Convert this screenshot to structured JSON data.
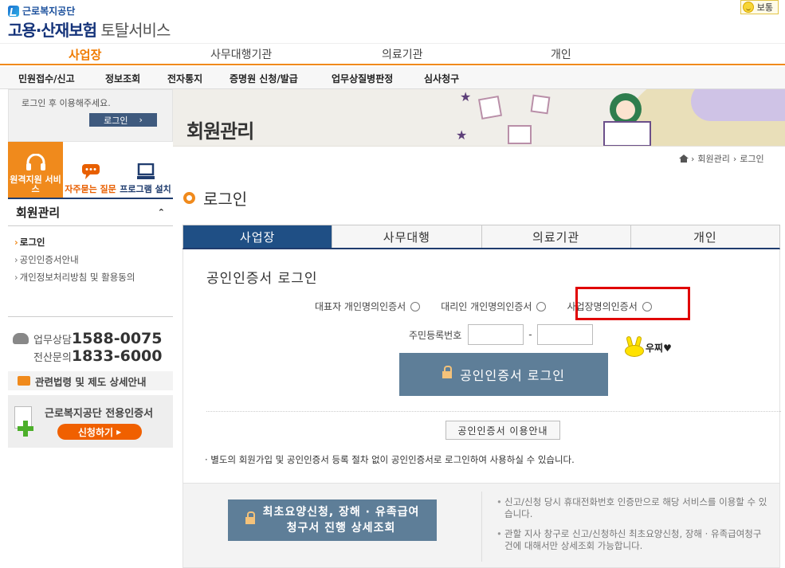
{
  "header": {
    "org_name": "근로복지공단",
    "service_strong": "고용·산재보험",
    "service_light": "토탈서비스",
    "mood_label": "보통"
  },
  "main_nav": [
    {
      "label": "사업장"
    },
    {
      "label": "사무대행기관"
    },
    {
      "label": "의료기관"
    },
    {
      "label": "개인"
    }
  ],
  "sub_nav": [
    {
      "label": "민원접수/신고"
    },
    {
      "label": "정보조회"
    },
    {
      "label": "전자통지"
    },
    {
      "label": "증명원 신청/발급"
    },
    {
      "label": "업무상질병판정"
    },
    {
      "label": "심사청구"
    }
  ],
  "sidebar": {
    "login_message": "로그인 후 이용해주세요.",
    "login_button": "로그인",
    "quick_links": [
      {
        "label": "원격지원 서비스",
        "icon": "headset-icon"
      },
      {
        "label": "자주묻는 질문",
        "icon": "chat-icon"
      },
      {
        "label": "프로그램 설치",
        "icon": "monitor-icon"
      }
    ],
    "menu_title": "회원관리",
    "menu_items": [
      {
        "label": "로그인"
      },
      {
        "label": "공인인증서안내"
      },
      {
        "label": "개인정보처리방침 및 활용동의"
      }
    ],
    "phone_line1_label": "업무상담",
    "phone_line1_number": "1588-0075",
    "phone_line2_label": "전산문의",
    "phone_line2_number": "1833-6000",
    "law_link": "관련법령 및 제도 상세안내",
    "cert_title": "근로복지공단 전용인증서",
    "cert_button": "신청하기"
  },
  "banner": {
    "title": "회원관리"
  },
  "breadcrumb": {
    "level1": "회원관리",
    "level2": "로그인"
  },
  "section_title": "로그인",
  "tabs": [
    {
      "label": "사업장"
    },
    {
      "label": "사무대행"
    },
    {
      "label": "의료기관"
    },
    {
      "label": "개인"
    }
  ],
  "login_panel": {
    "cert_login_title": "공인인증서 로그인",
    "radio_options": [
      {
        "label": "대표자 개인명의인증서"
      },
      {
        "label": "대리인 개인명의인증서"
      },
      {
        "label": "사업장명의인증서"
      }
    ],
    "ssn_label": "주민등록번호",
    "ssn_dash": "-",
    "login_button": "공인인증서 로그인",
    "guide_button": "공인인증서 이용안내",
    "note": "· 별도의 회원가입 및 공인인증서 등록 절차 없이 공인인증서로 로그인하여 사용하실 수 있습니다."
  },
  "annotation": {
    "label": "우찌♥"
  },
  "bottom": {
    "button_line1": "최초요양신청, 장해 · 유족급여",
    "button_line2": "청구서 진행 상세조회",
    "info1": "신고/신청 당시 휴대전화번호 인증만으로 해당 서비스를 이용할 수 있습니다.",
    "info2": "관할 지사 창구로 신고/신청하신 최초요양신청, 장해 · 유족급여청구건에 대해서만 상세조회 가능합니다."
  },
  "colors": {
    "accent_orange": "#f08a1c",
    "navy": "#1f4f85",
    "button_slate": "#5e7e98",
    "highlight_red": "#e00000"
  }
}
